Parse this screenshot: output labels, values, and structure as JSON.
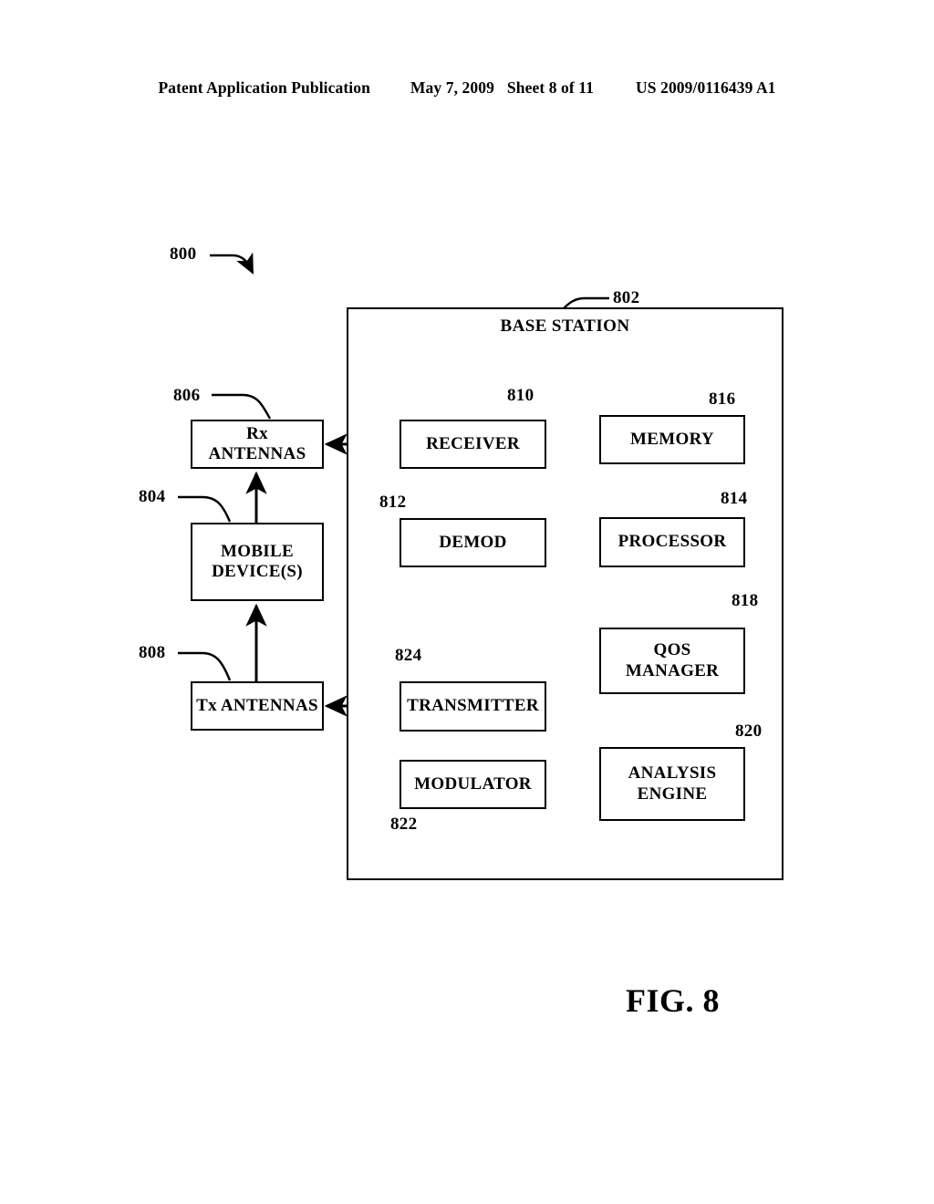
{
  "header": {
    "publication": "Patent Application Publication",
    "date": "May 7, 2009",
    "sheet": "Sheet 8 of 11",
    "number": "US 2009/0116439 A1"
  },
  "figure": {
    "caption": "FIG. 8",
    "system_ref": "800"
  },
  "container": {
    "title": "BASE STATION",
    "ref": "802"
  },
  "nodes": [
    {
      "id": "mobile-devices",
      "label": "MOBILE\nDEVICE(S)",
      "line1": "MOBILE",
      "line2": "DEVICE(S)",
      "ref": "804"
    },
    {
      "id": "rx-antennas",
      "label": "Rx ANTENNAS",
      "ref": "806"
    },
    {
      "id": "tx-antennas",
      "label": "Tx ANTENNAS",
      "ref": "808"
    },
    {
      "id": "receiver",
      "label": "RECEIVER",
      "ref": "810"
    },
    {
      "id": "demod",
      "label": "DEMOD",
      "ref": "812"
    },
    {
      "id": "processor",
      "label": "PROCESSOR",
      "ref": "814"
    },
    {
      "id": "memory",
      "label": "MEMORY",
      "ref": "816"
    },
    {
      "id": "qos-manager",
      "label": "QOS MANAGER",
      "ref": "818"
    },
    {
      "id": "analysis-engine",
      "label": "ANALYSIS\nENGINE",
      "line1": "ANALYSIS",
      "line2": "ENGINE",
      "ref": "820"
    },
    {
      "id": "modulator",
      "label": "MODULATOR",
      "ref": "822"
    },
    {
      "id": "transmitter",
      "label": "TRANSMITTER",
      "ref": "824"
    }
  ],
  "labels": {
    "base_station": "BASE STATION",
    "mobile_devices_line1": "MOBILE",
    "mobile_devices_line2": "DEVICE(S)",
    "rx_antennas": "Rx ANTENNAS",
    "tx_antennas": "Tx ANTENNAS",
    "receiver": "RECEIVER",
    "demod": "DEMOD",
    "processor": "PROCESSOR",
    "memory": "MEMORY",
    "qos_manager": "QOS MANAGER",
    "analysis_engine_line1": "ANALYSIS",
    "analysis_engine_line2": "ENGINE",
    "modulator": "MODULATOR",
    "transmitter": "TRANSMITTER"
  },
  "refs": {
    "r800": "800",
    "r802": "802",
    "r804": "804",
    "r806": "806",
    "r808": "808",
    "r810": "810",
    "r812": "812",
    "r814": "814",
    "r816": "816",
    "r818": "818",
    "r820": "820",
    "r822": "822",
    "r824": "824"
  },
  "connections": [
    {
      "from": "mobile-devices",
      "to": "rx-antennas",
      "direction": "one-way"
    },
    {
      "from": "tx-antennas",
      "to": "mobile-devices",
      "direction": "one-way"
    },
    {
      "from": "rx-antennas",
      "to": "receiver",
      "direction": "two-way"
    },
    {
      "from": "tx-antennas",
      "to": "transmitter",
      "direction": "two-way"
    },
    {
      "from": "receiver",
      "to": "demod",
      "direction": "one-way"
    },
    {
      "from": "demod",
      "to": "processor",
      "direction": "one-way"
    },
    {
      "from": "memory",
      "to": "processor",
      "direction": "two-way"
    },
    {
      "from": "processor",
      "to": "qos-manager",
      "direction": "two-way"
    },
    {
      "from": "qos-manager",
      "to": "analysis-engine",
      "direction": "two-way"
    },
    {
      "from": "modulator",
      "to": "analysis-engine",
      "direction": "two-way"
    },
    {
      "from": "modulator",
      "to": "transmitter",
      "direction": "one-way"
    }
  ],
  "colors": {
    "ink": "#000000",
    "paper": "#ffffff"
  }
}
